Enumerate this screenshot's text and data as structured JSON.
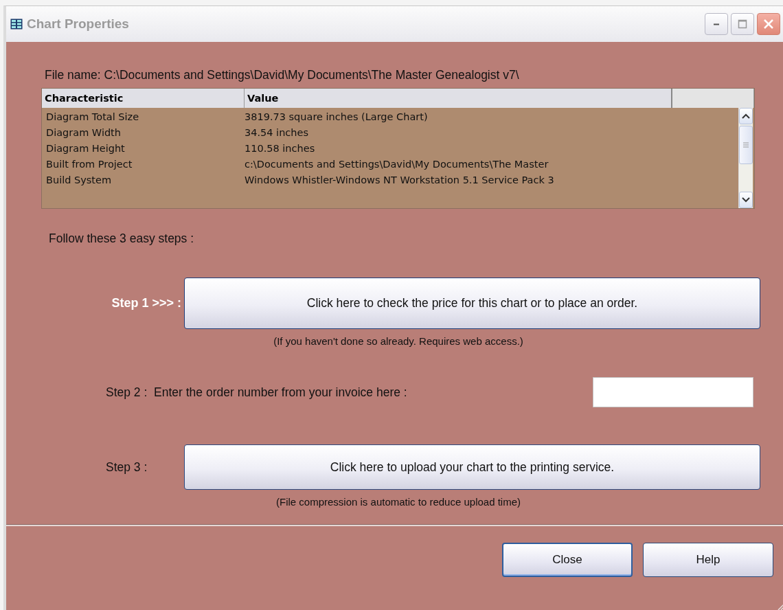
{
  "window": {
    "title": "Chart Properties"
  },
  "file_name": "File name: C:\\Documents and Settings\\David\\My Documents\\The Master Genealogist v7\\",
  "table": {
    "columns": [
      "Characteristic",
      "Value"
    ],
    "rows": [
      [
        "Diagram Total Size",
        "3819.73 square inches (Large Chart)"
      ],
      [
        "Diagram Width",
        "34.54 inches"
      ],
      [
        "Diagram Height",
        "110.58 inches"
      ],
      [
        "Built from Project",
        "c:\\Documents and Settings\\David\\My Documents\\The Master"
      ],
      [
        "Build System",
        "Windows Whistler-Windows NT Workstation  5.1 Service Pack 3"
      ]
    ]
  },
  "intro": "Follow these 3 easy steps :",
  "step1": {
    "label": "Step 1 >>> :",
    "button": "Click here to check the price for this chart or to place an order.",
    "note": "(If you haven't done so already.  Requires web access.)"
  },
  "step2": {
    "label": "Step 2 :  Enter the order number from your invoice here :"
  },
  "step3": {
    "label": "Step 3 :",
    "button": "Click here to upload your chart to the printing service.",
    "note": "(File compression is automatic to reduce upload time)"
  },
  "buttons": [
    {
      "label": "Close",
      "default": true
    },
    {
      "label": "Help",
      "default": false
    }
  ]
}
